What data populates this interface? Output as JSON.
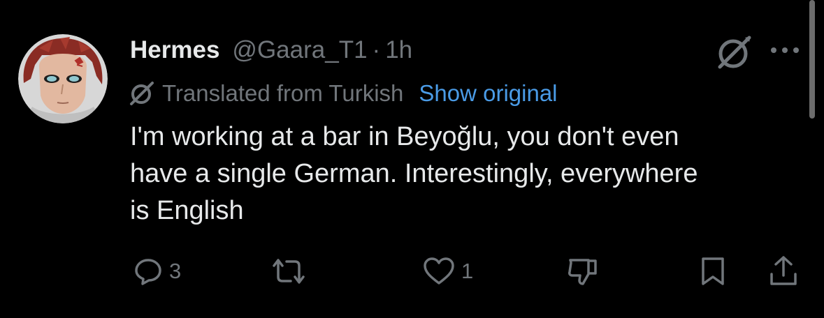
{
  "tweet": {
    "author": {
      "display_name": "Hermes",
      "handle": "@Gaara_T1",
      "avatar_icon": "avatar-image"
    },
    "separator": "·",
    "time": "1h",
    "translation": {
      "label": "Translated from Turkish",
      "show_original": "Show original"
    },
    "text": "I'm working at a bar in Beyoğlu, you don't even\nhave a single German. Interestingly, everywhere\nis English",
    "actions": {
      "replies": "3",
      "reposts": "",
      "likes": "1"
    }
  },
  "icons": {
    "grok": "grok-icon",
    "more": "more-icon",
    "translate": "translate-icon",
    "reply": "reply-icon",
    "repost": "repost-icon",
    "like": "heart-icon",
    "dislike": "thumbs-down-icon",
    "bookmark": "bookmark-icon",
    "share": "share-icon"
  },
  "colors": {
    "background": "#000000",
    "text": "#e7e9ea",
    "muted": "#71767b",
    "link": "#4a9be6"
  }
}
